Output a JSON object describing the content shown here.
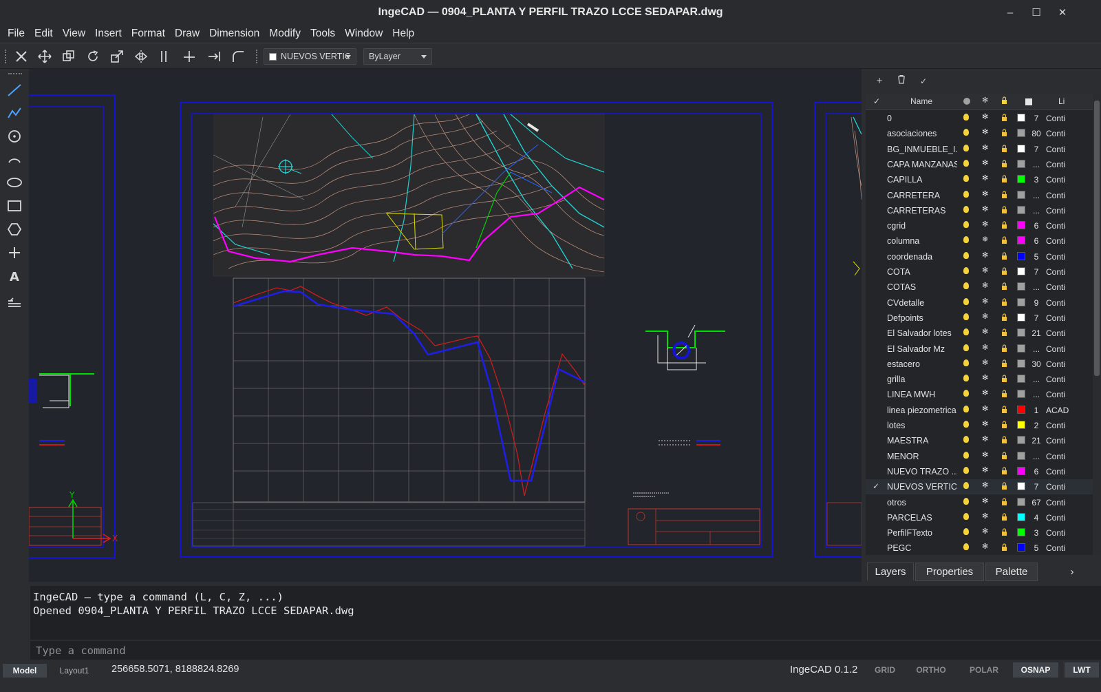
{
  "window": {
    "title": "IngeCAD — 0904_PLANTA Y PERFIL TRAZO LCCE SEDAPAR.dwg",
    "minimize": "–",
    "maximize": "☐",
    "close": "✕"
  },
  "menu": [
    "File",
    "Edit",
    "View",
    "Insert",
    "Format",
    "Draw",
    "Dimension",
    "Modify",
    "Tools",
    "Window",
    "Help"
  ],
  "toolbar": {
    "tools": [
      "erase-icon",
      "move-icon",
      "copy-icon",
      "rotate-icon",
      "scale-icon",
      "mirror-icon",
      "offset-icon",
      "trim-icon",
      "extend-icon",
      "fillet-icon"
    ],
    "layer_combo": "NUEVOS VERTICE",
    "layer_swatch_color": "#ffffff",
    "linetype_combo": "ByLayer"
  },
  "draw_tools": [
    "line-icon",
    "polyline-icon",
    "circle-icon",
    "arc-icon",
    "ellipse-icon",
    "rectangle-icon",
    "polygon-icon",
    "point-icon",
    "text-icon",
    "hatch-icon"
  ],
  "canvas": {
    "ucs_x": "X",
    "ucs_y": "Y",
    "colors": {
      "background": "#22252b",
      "frame": "#1414d6",
      "profile_design": "#1e1ee8",
      "profile_ground": "#c81e1e",
      "trace": "#ff00ff",
      "titleblock": "#c0392b"
    }
  },
  "layers_panel": {
    "add_icon": "plus-icon",
    "delete_icon": "trash-icon",
    "set_current_icon": "check-icon",
    "header": {
      "check": "✓",
      "name": "Name",
      "linetype": "Li"
    },
    "rows": [
      {
        "name": "0",
        "color": "#ffffff",
        "num": "7",
        "linetype": "Conti",
        "frozen": false,
        "current": false
      },
      {
        "name": "asociaciones",
        "color": "#a0a0a0",
        "num": "80",
        "linetype": "Conti",
        "frozen": false,
        "current": false
      },
      {
        "name": "BG_INMUEBLE_I...",
        "color": "#ffffff",
        "num": "7",
        "linetype": "Conti",
        "frozen": false,
        "current": false
      },
      {
        "name": "CAPA MANZANAS",
        "color": "#a0a0a0",
        "num": "...",
        "linetype": "Conti",
        "frozen": false,
        "current": false
      },
      {
        "name": "CAPILLA",
        "color": "#00ff00",
        "num": "3",
        "linetype": "Conti",
        "frozen": false,
        "current": false
      },
      {
        "name": "CARRETERA",
        "color": "#a0a0a0",
        "num": "...",
        "linetype": "Conti",
        "frozen": false,
        "current": false
      },
      {
        "name": "CARRETERAS",
        "color": "#a0a0a0",
        "num": "...",
        "linetype": "Conti",
        "frozen": false,
        "current": false
      },
      {
        "name": "cgrid",
        "color": "#ff00ff",
        "num": "6",
        "linetype": "Conti",
        "frozen": false,
        "current": false
      },
      {
        "name": "columna",
        "color": "#ff00ff",
        "num": "6",
        "linetype": "Conti",
        "frozen": true,
        "current": false
      },
      {
        "name": "coordenada",
        "color": "#0000ff",
        "num": "5",
        "linetype": "Conti",
        "frozen": false,
        "current": false
      },
      {
        "name": "COTA",
        "color": "#ffffff",
        "num": "7",
        "linetype": "Conti",
        "frozen": false,
        "current": false
      },
      {
        "name": "COTAS",
        "color": "#a0a0a0",
        "num": "...",
        "linetype": "Conti",
        "frozen": false,
        "current": false
      },
      {
        "name": "CVdetalle",
        "color": "#a0a0a0",
        "num": "9",
        "linetype": "Conti",
        "frozen": false,
        "current": false
      },
      {
        "name": "Defpoints",
        "color": "#ffffff",
        "num": "7",
        "linetype": "Conti",
        "frozen": false,
        "current": false
      },
      {
        "name": "El Salvador lotes",
        "color": "#a0a0a0",
        "num": "21",
        "linetype": "Conti",
        "frozen": false,
        "current": false
      },
      {
        "name": "El Salvador Mz",
        "color": "#a0a0a0",
        "num": "...",
        "linetype": "Conti",
        "frozen": false,
        "current": false
      },
      {
        "name": "estacero",
        "color": "#a0a0a0",
        "num": "30",
        "linetype": "Conti",
        "frozen": false,
        "current": false
      },
      {
        "name": "grilla",
        "color": "#a0a0a0",
        "num": "...",
        "linetype": "Conti",
        "frozen": false,
        "current": false
      },
      {
        "name": "LINEA MWH",
        "color": "#a0a0a0",
        "num": "...",
        "linetype": "Conti",
        "frozen": false,
        "current": false
      },
      {
        "name": "linea piezometrica",
        "color": "#ff0000",
        "num": "1",
        "linetype": "ACAD",
        "frozen": false,
        "current": false
      },
      {
        "name": "lotes",
        "color": "#ffff00",
        "num": "2",
        "linetype": "Conti",
        "frozen": false,
        "current": false
      },
      {
        "name": "MAESTRA",
        "color": "#a0a0a0",
        "num": "21",
        "linetype": "Conti",
        "frozen": false,
        "current": false
      },
      {
        "name": "MENOR",
        "color": "#a0a0a0",
        "num": "...",
        "linetype": "Conti",
        "frozen": false,
        "current": false
      },
      {
        "name": "NUEVO TRAZO ...",
        "color": "#ff00ff",
        "num": "6",
        "linetype": "Conti",
        "frozen": false,
        "current": false
      },
      {
        "name": "NUEVOS VERTICES",
        "color": "#ffffff",
        "num": "7",
        "linetype": "Conti",
        "frozen": false,
        "current": true
      },
      {
        "name": "otros",
        "color": "#a0a0a0",
        "num": "67",
        "linetype": "Conti",
        "frozen": false,
        "current": false
      },
      {
        "name": "PARCELAS",
        "color": "#00ffff",
        "num": "4",
        "linetype": "Conti",
        "frozen": false,
        "current": false
      },
      {
        "name": "PerfilFTexto",
        "color": "#00ff00",
        "num": "3",
        "linetype": "Conti",
        "frozen": false,
        "current": false
      },
      {
        "name": "PEGC",
        "color": "#0000ff",
        "num": "5",
        "linetype": "Conti",
        "frozen": false,
        "current": false
      }
    ]
  },
  "panel_tabs": [
    "Layers",
    "Properties",
    "Palette"
  ],
  "panel_tabs_more": "›",
  "command": {
    "history": [
      "IngeCAD — type a command (L, C, Z, ...)",
      "Opened 0904_PLANTA Y PERFIL TRAZO LCCE SEDAPAR.dwg"
    ],
    "placeholder": "Type a command"
  },
  "statusbar": {
    "model_tab": "Model",
    "layout_tab": "Layout1",
    "coordinates": "256658.5071, 8188824.8269",
    "version": "IngeCAD 0.1.2",
    "toggles": [
      {
        "label": "GRID",
        "on": false
      },
      {
        "label": "ORTHO",
        "on": false
      },
      {
        "label": "POLAR",
        "on": false
      },
      {
        "label": "OSNAP",
        "on": true
      },
      {
        "label": "LWT",
        "on": true
      }
    ]
  }
}
